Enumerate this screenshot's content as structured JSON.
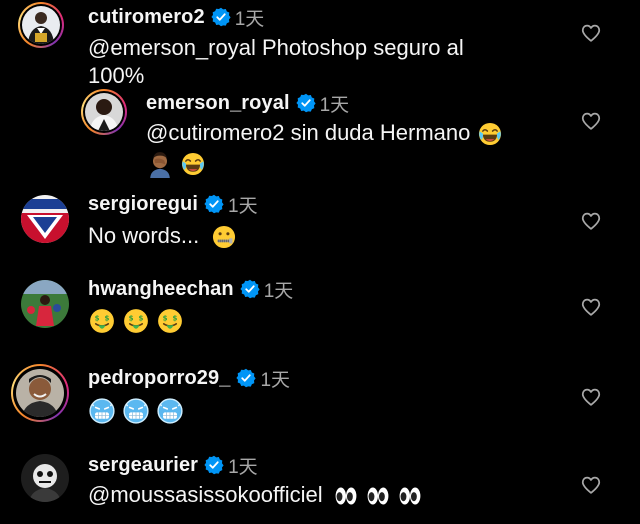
{
  "comments": [
    {
      "username": "cutiromero2",
      "time": "1天",
      "text": "@emerson_royal Photoshop seguro al 100%",
      "text_line1": "@emerson_royal Photoshop seguro al",
      "text_line2": "100%"
    },
    {
      "username": "emerson_royal",
      "time": "1天",
      "text": "@cutiromero2 sin duda Hermano 😂 🤦🏾‍♂️😂",
      "mention": "@cutiromero2 sin duda Hermano"
    },
    {
      "username": "sergioregui",
      "time": "1天",
      "text": "No words... 🤐",
      "body": "No words..."
    },
    {
      "username": "hwangheechan",
      "time": "1天",
      "text": "🤑🤑🤑"
    },
    {
      "username": "pedroporro29_",
      "time": "1天",
      "text": "🥶🥶🥶"
    },
    {
      "username": "sergeaurier",
      "time": "1天",
      "text": "@moussasissokoofficiel 👀👀👀",
      "mention": "@moussasissokoofficiel"
    }
  ],
  "icons": {
    "verified": "verified-badge-icon",
    "like": "heart-outline-icon"
  },
  "colors": {
    "background": "#000000",
    "text": "#f5f5f5",
    "muted": "#a8a8a8",
    "verified": "#0095f6"
  }
}
